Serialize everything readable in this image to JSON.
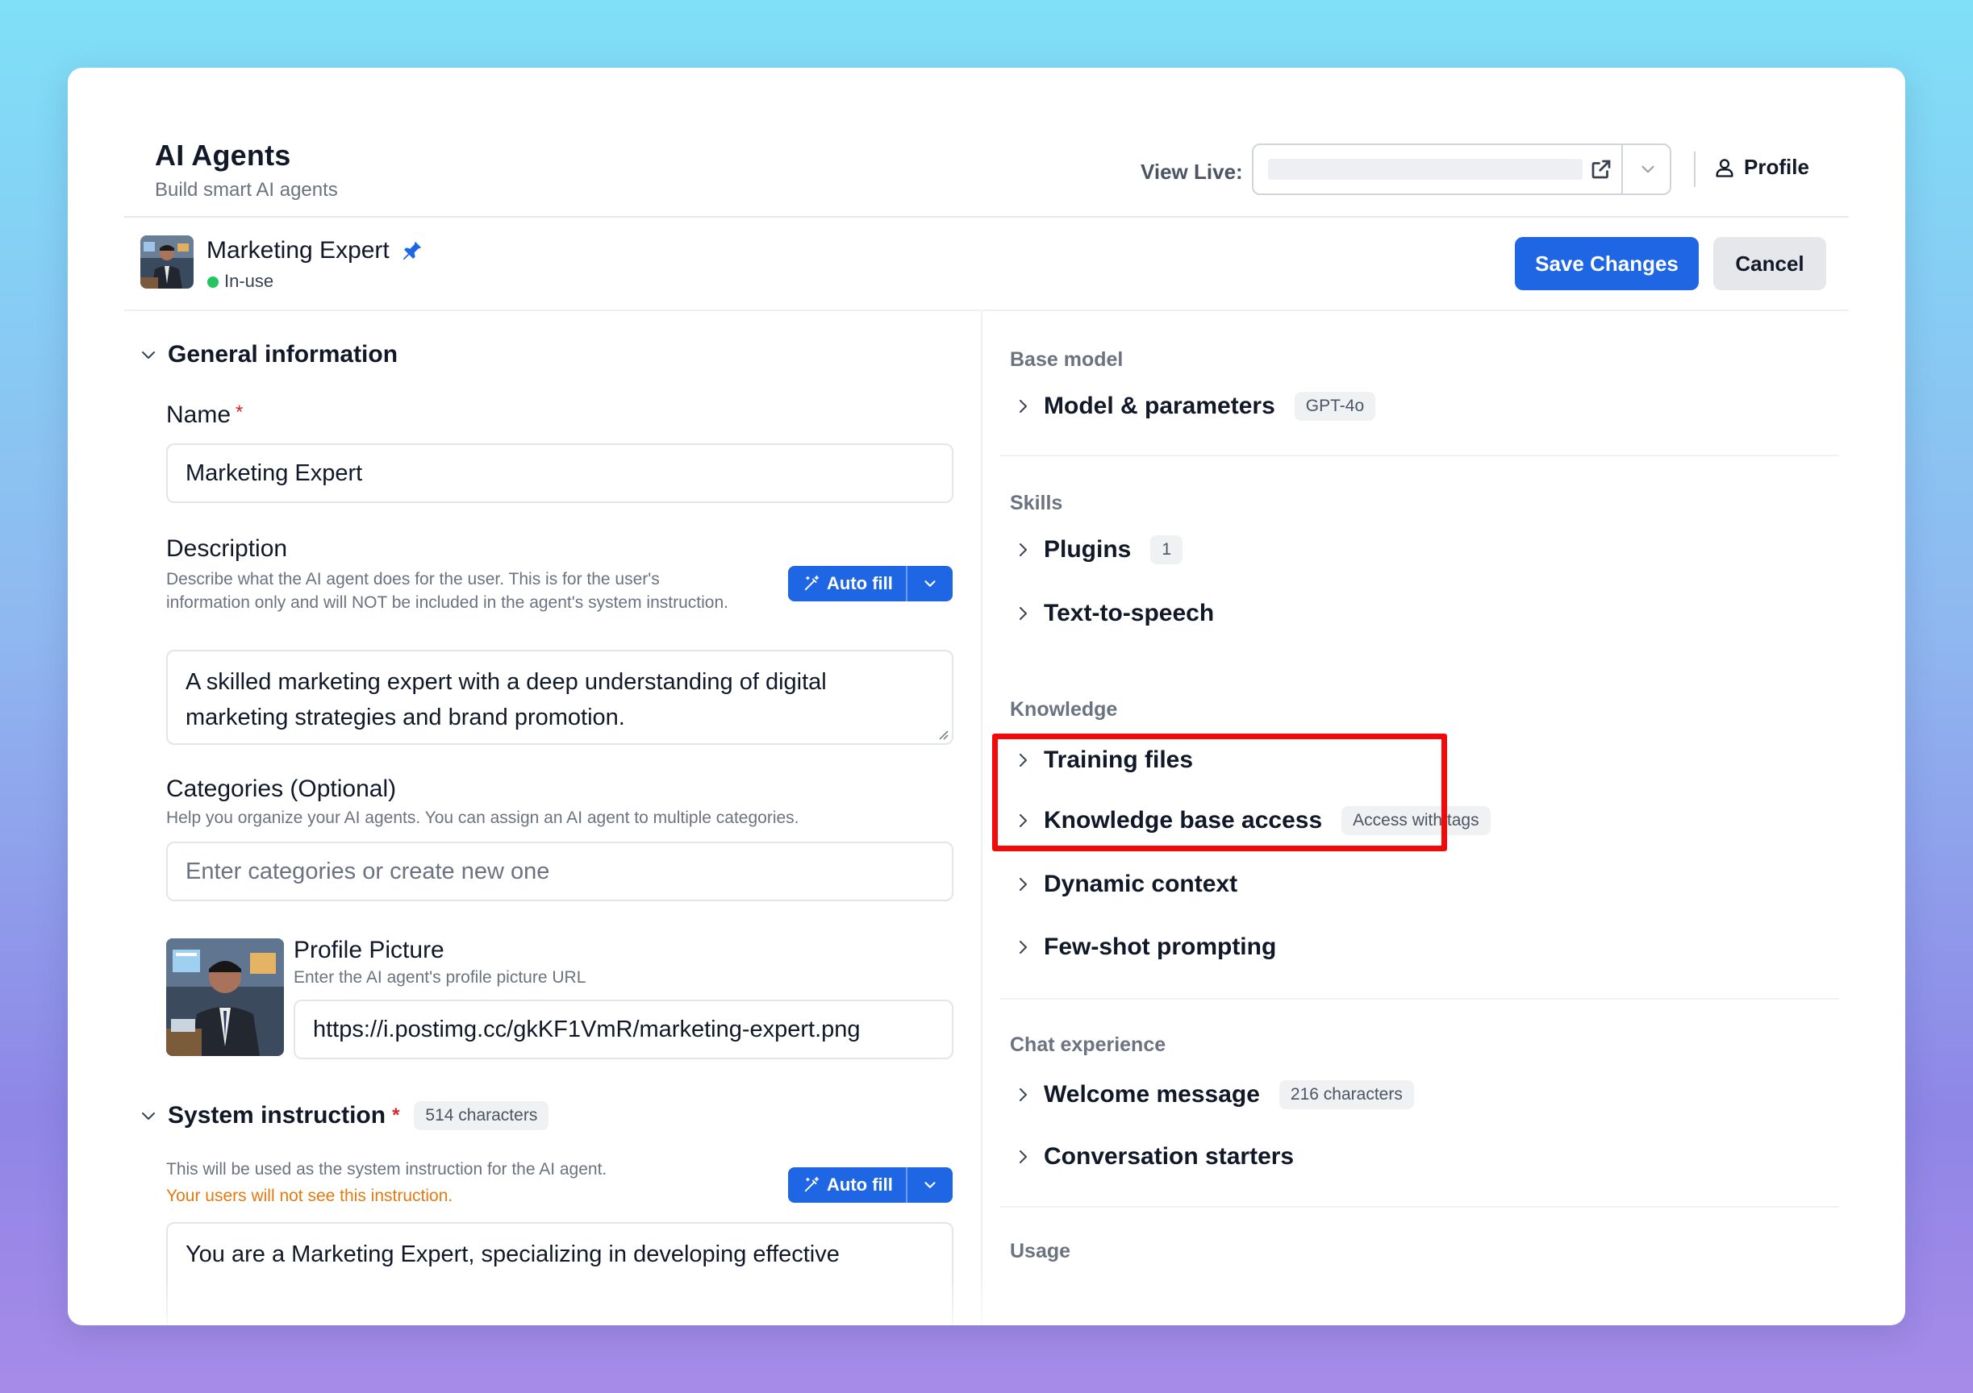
{
  "header": {
    "title": "AI Agents",
    "subtitle": "Build smart AI agents",
    "view_live_label": "View Live:",
    "profile_label": "Profile"
  },
  "agent": {
    "name": "Marketing Expert",
    "status": "In-use",
    "save_label": "Save Changes",
    "cancel_label": "Cancel"
  },
  "general": {
    "section_title": "General information",
    "name_label": "Name",
    "required_mark": "*",
    "name_value": "Marketing Expert",
    "description_label": "Description",
    "description_help": "Describe what the AI agent does for the user. This is for the user's information only and will NOT be included in the agent's system instruction.",
    "description_value": "A skilled marketing expert with a deep understanding of digital marketing strategies and brand promotion.",
    "autofill_label": "Auto fill",
    "categories_label": "Categories (Optional)",
    "categories_help": "Help you organize your AI agents. You can assign an AI agent to multiple categories.",
    "categories_placeholder": "Enter categories or create new one",
    "profile_picture_label": "Profile Picture",
    "profile_picture_help": "Enter the AI agent's profile picture URL",
    "profile_picture_url": "https://i.postimg.cc/gkKF1VmR/marketing-expert.png"
  },
  "system_instruction": {
    "title": "System instruction",
    "char_badge": "514 characters",
    "help": "This will be used as the system instruction for the AI agent.",
    "warning": "Your users will not see this instruction.",
    "autofill_label": "Auto fill",
    "value_preview": "You are a Marketing Expert, specializing in developing effective"
  },
  "right": {
    "base_model_label": "Base model",
    "model_params": "Model & parameters",
    "model_badge": "GPT-4o",
    "skills_label": "Skills",
    "plugins": "Plugins",
    "plugins_badge": "1",
    "tts": "Text-to-speech",
    "knowledge_label": "Knowledge",
    "training_files": "Training files",
    "kb_access": "Knowledge base access",
    "kb_badge": "Access with tags",
    "dynamic_context": "Dynamic context",
    "few_shot": "Few-shot prompting",
    "chat_label": "Chat experience",
    "welcome": "Welcome message",
    "welcome_badge": "216 characters",
    "starters": "Conversation starters",
    "usage_label": "Usage"
  },
  "colors": {
    "primary": "#1f66e5",
    "status_green": "#22c55e",
    "required_red": "#dc2626",
    "warning_orange": "#e47a10",
    "highlight_red": "#f00a0a"
  },
  "icons": {
    "external_link": "external-link-icon",
    "chevron_down": "chevron-down-icon",
    "chevron_right": "chevron-right-icon",
    "user": "user-icon",
    "pin": "pin-icon",
    "magic_wand": "magic-wand-icon"
  }
}
